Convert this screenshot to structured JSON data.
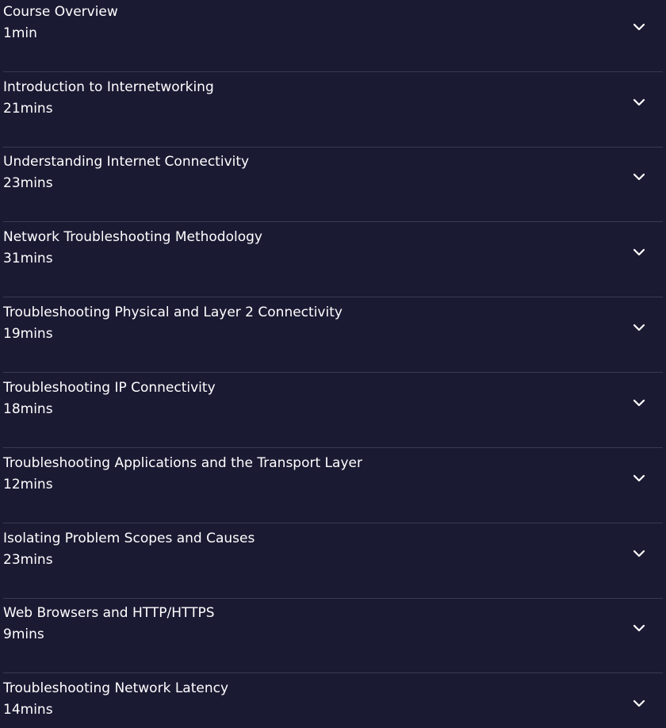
{
  "modules": [
    {
      "title": "Course Overview",
      "duration": "1min"
    },
    {
      "title": "Introduction to Internetworking",
      "duration": "21mins"
    },
    {
      "title": "Understanding Internet Connectivity",
      "duration": "23mins"
    },
    {
      "title": "Network Troubleshooting Methodology",
      "duration": "31mins"
    },
    {
      "title": "Troubleshooting Physical and Layer 2 Connectivity",
      "duration": "19mins"
    },
    {
      "title": "Troubleshooting IP Connectivity",
      "duration": "18mins"
    },
    {
      "title": "Troubleshooting Applications and the Transport Layer",
      "duration": "12mins"
    },
    {
      "title": "Isolating Problem Scopes and Causes",
      "duration": "23mins"
    },
    {
      "title": "Web Browsers and HTTP/HTTPS",
      "duration": "9mins"
    },
    {
      "title": "Troubleshooting Network Latency",
      "duration": "14mins"
    }
  ],
  "icons": {
    "expand": "chevron-down-icon"
  },
  "colors": {
    "background": "#1b1a33",
    "divider": "#3a3a56",
    "text": "#ffffff"
  }
}
